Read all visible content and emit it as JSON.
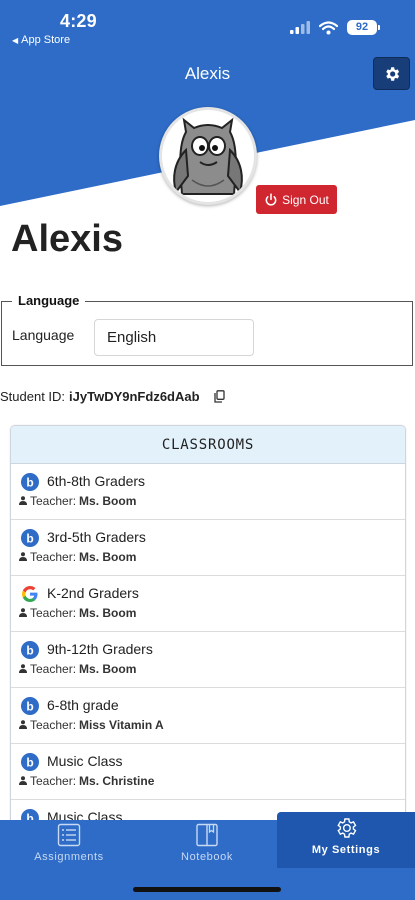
{
  "status_bar": {
    "time": "4:29",
    "back_app": "App Store",
    "battery": "92"
  },
  "header": {
    "title": "Alexis"
  },
  "profile": {
    "name": "Alexis",
    "sign_out_label": "Sign Out"
  },
  "language": {
    "legend": "Language",
    "label": "Language",
    "value": "English"
  },
  "student": {
    "id_label": "Student ID:",
    "id_value": "iJyTwDY9nFdz6dAab"
  },
  "classrooms": {
    "title": "CLASSROOMS",
    "teacher_label": "Teacher:",
    "items": [
      {
        "name": "6th-8th Graders",
        "teacher": "Ms. Boom",
        "icon": "b-logo-icon"
      },
      {
        "name": "3rd-5th Graders",
        "teacher": "Ms. Boom",
        "icon": "b-logo-icon"
      },
      {
        "name": "K-2nd Graders",
        "teacher": "Ms. Boom",
        "icon": "google-logo-icon"
      },
      {
        "name": "9th-12th Graders",
        "teacher": "Ms. Boom",
        "icon": "b-logo-icon"
      },
      {
        "name": "6-8th grade",
        "teacher": "Miss Vitamin A",
        "icon": "b-logo-icon"
      },
      {
        "name": "Music Class",
        "teacher": "Ms. Christine",
        "icon": "b-logo-icon"
      },
      {
        "name": "Music Class",
        "teacher": "",
        "icon": "b-logo-icon"
      }
    ]
  },
  "tabs": [
    {
      "label": "Assignments",
      "icon": "list-icon"
    },
    {
      "label": "Notebook",
      "icon": "notebook-icon"
    },
    {
      "label": "My Settings",
      "icon": "gear-icon",
      "active": true
    }
  ],
  "colors": {
    "brand": "#2e6cc7",
    "signout": "#d0262f",
    "card_header": "#e3f1fb"
  }
}
